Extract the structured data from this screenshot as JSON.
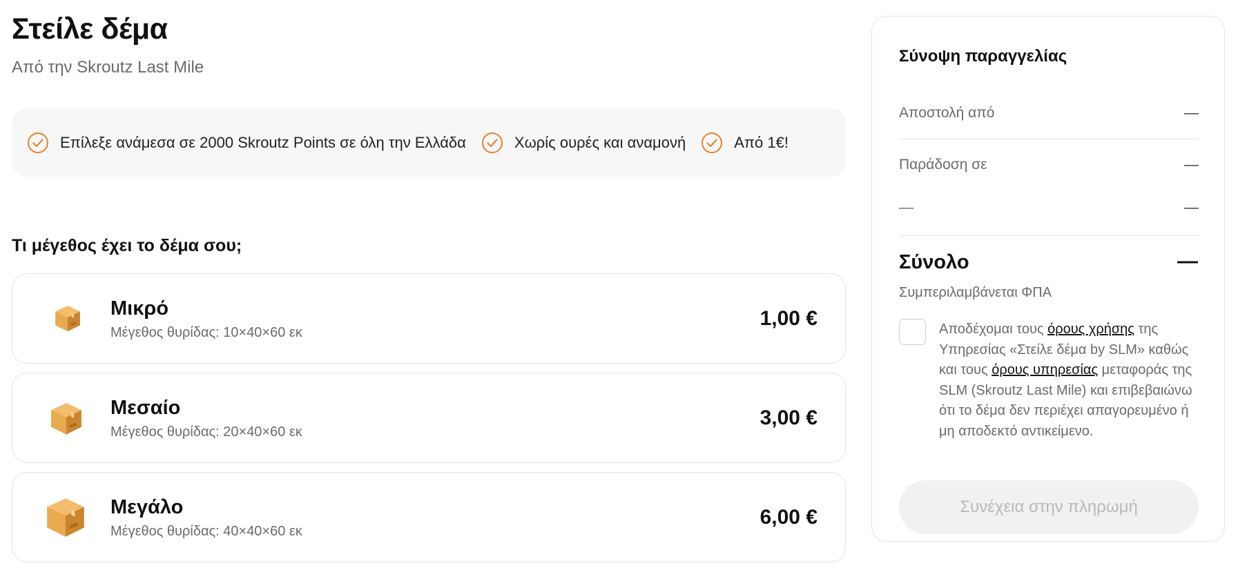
{
  "header": {
    "title": "Στείλε δέμα",
    "subtitle": "Από την Skroutz Last Mile"
  },
  "features": [
    {
      "icon": "check-circle-icon",
      "text": "Επίλεξε ανάμεσα σε 2000 Skroutz Points σε όλη την Ελλάδα"
    },
    {
      "icon": "check-circle-icon",
      "text": "Χωρίς ουρές και αναμονή"
    },
    {
      "icon": "check-circle-icon",
      "text": "Από 1€!"
    }
  ],
  "size_question": "Τι μέγεθος έχει το δέμα σου;",
  "sizes": [
    {
      "icon": "package-icon",
      "name": "Μικρό",
      "dims": "Μέγεθος θυρίδας: 10×40×60 εκ",
      "price": "1,00 €"
    },
    {
      "icon": "package-icon",
      "name": "Μεσαίο",
      "dims": "Μέγεθος θυρίδας: 20×40×60 εκ",
      "price": "3,00 €"
    },
    {
      "icon": "package-icon",
      "name": "Μεγάλο",
      "dims": "Μέγεθος θυρίδας: 40×40×60 εκ",
      "price": "6,00 €"
    }
  ],
  "summary": {
    "title": "Σύνοψη παραγγελίας",
    "rows": [
      {
        "label": "Αποστολή από",
        "value": "—"
      },
      {
        "label": "Παράδοση σε",
        "value": "—"
      },
      {
        "label": "—",
        "value": "—"
      }
    ],
    "total_label": "Σύνολο",
    "total_value": "—",
    "vat_note": "Συμπεριλαμβάνεται ΦΠΑ",
    "terms": {
      "part1": "Αποδέχομαι τους ",
      "link1": "όρους χρήσης",
      "part2": " της Υπηρεσίας «Στείλε δέμα by SLM» καθώς και τους ",
      "link2": "όρους υπηρεσίας",
      "part3": " μεταφοράς της SLM (Skroutz Last Mile) και επιβεβαιώνω ότι το δέμα δεν περιέχει απαγορευμένο ή μη αποδεκτό αντικείμενο.",
      "checked": false
    },
    "continue_label": "Συνέχεια στην πληρωμή"
  },
  "colors": {
    "accent": "#e8822a",
    "box_light": "#e8a94f",
    "box_dark": "#c9862f",
    "disabled_button_bg": "#f1f1f2",
    "disabled_button_text": "#b9b9bd"
  }
}
